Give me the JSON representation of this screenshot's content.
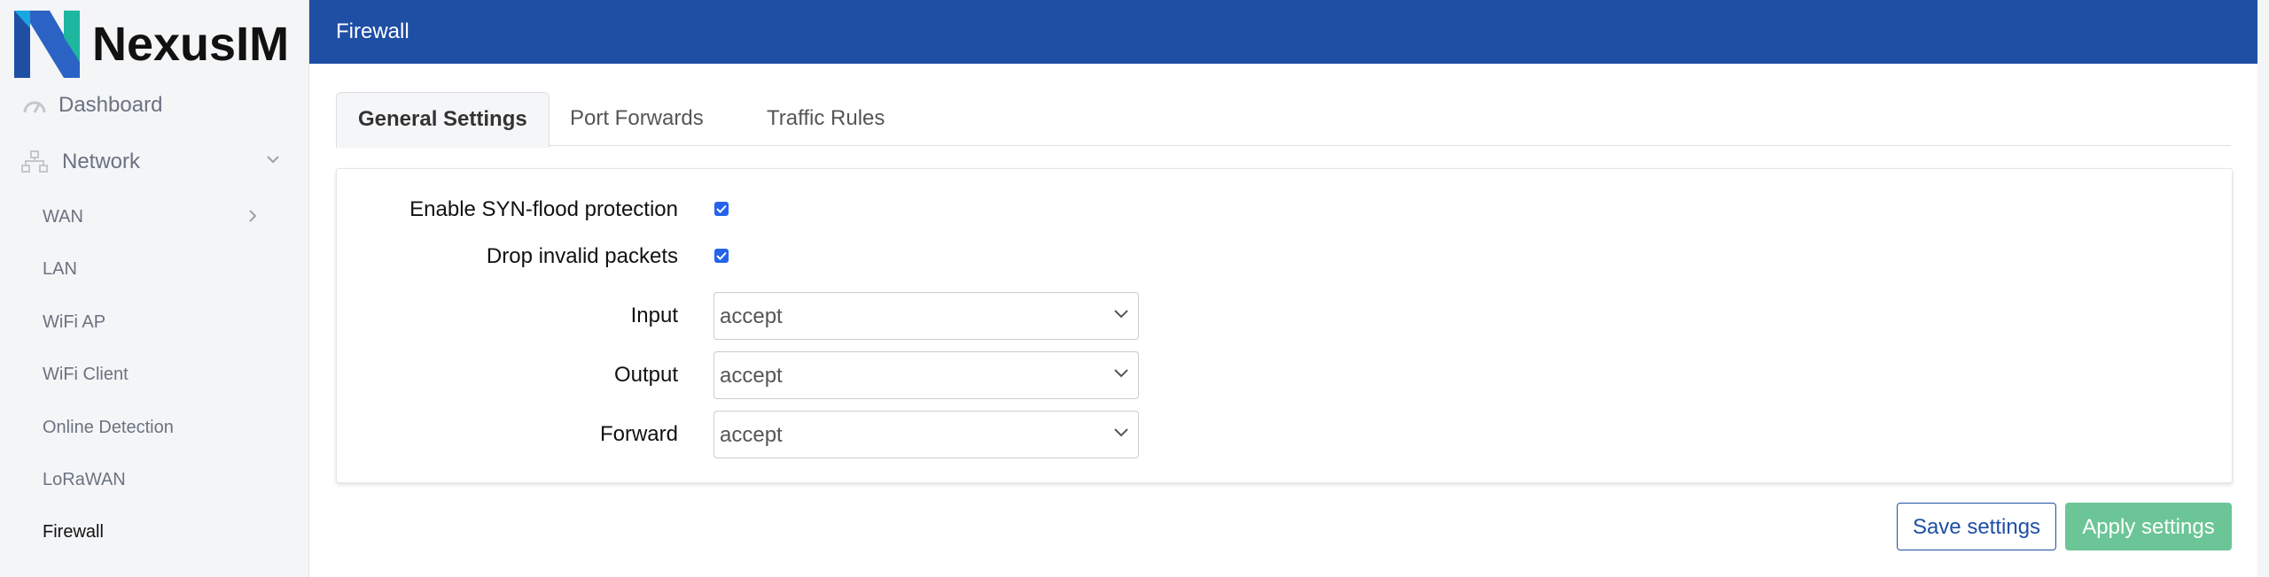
{
  "brand": {
    "name": "NexusIM"
  },
  "sidebar": {
    "dashboard_label": "Dashboard",
    "network_label": "Network",
    "items": [
      {
        "label": "WAN"
      },
      {
        "label": "LAN"
      },
      {
        "label": "WiFi AP"
      },
      {
        "label": "WiFi Client"
      },
      {
        "label": "Online Detection"
      },
      {
        "label": "LoRaWAN"
      },
      {
        "label": "Firewall"
      }
    ],
    "active_item": "Firewall"
  },
  "header": {
    "title": "Firewall"
  },
  "tabs": [
    {
      "label": "General Settings",
      "active": true
    },
    {
      "label": "Port Forwards",
      "active": false
    },
    {
      "label": "Traffic Rules",
      "active": false
    }
  ],
  "form": {
    "syn_flood_label": "Enable SYN-flood protection",
    "syn_flood_checked": true,
    "drop_invalid_label": "Drop invalid packets",
    "drop_invalid_checked": true,
    "input_label": "Input",
    "input_value": "accept",
    "output_label": "Output",
    "output_value": "accept",
    "forward_label": "Forward",
    "forward_value": "accept"
  },
  "buttons": {
    "save_label": "Save settings",
    "apply_label": "Apply settings"
  },
  "colors": {
    "header_bg": "#1f4ea5",
    "apply_bg": "#6cc597",
    "checkbox": "#2563eb",
    "logo_green": "#1fb6a0",
    "logo_blue": "#1f4ea5"
  }
}
